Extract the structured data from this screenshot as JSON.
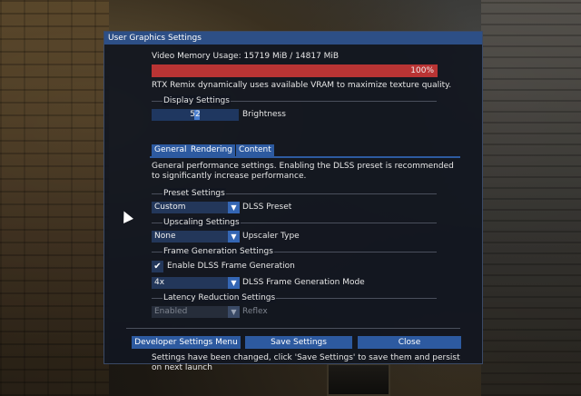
{
  "window": {
    "title": "User Graphics Settings"
  },
  "vram": {
    "label": "Video Memory Usage: 15719 MiB / 14817 MiB",
    "percent_text": "100%",
    "fill_fraction": 1.0,
    "note": "RTX Remix dynamically uses available VRAM to maximize texture quality.",
    "bar_color": "#b93434"
  },
  "display_settings": {
    "heading": "Display Settings",
    "brightness": {
      "value": "52",
      "label": "Brightness"
    }
  },
  "tabs": [
    {
      "label": "General",
      "active": true
    },
    {
      "label": "Rendering",
      "active": false
    },
    {
      "label": "Content",
      "active": false
    }
  ],
  "general": {
    "description_line1": "General performance settings. Enabling the DLSS preset is recommended",
    "description_line2": "to significantly increase performance.",
    "preset": {
      "heading": "Preset Settings",
      "value": "Custom",
      "label": "DLSS Preset"
    },
    "upscaling": {
      "heading": "Upscaling Settings",
      "value": "None",
      "label": "Upscaler Type"
    },
    "frame_generation": {
      "heading": "Frame Generation Settings",
      "enable_label": "Enable DLSS Frame Generation",
      "enabled": true,
      "mode_value": "4x",
      "mode_label": "DLSS Frame Generation Mode"
    },
    "latency": {
      "heading": "Latency Reduction Settings",
      "value": "Enabled",
      "label": "Reflex",
      "disabled": true
    }
  },
  "footer": {
    "developer_button": "Developer Settings Menu",
    "save_button": "Save Settings",
    "close_button": "Close",
    "notice_line1": "Settings have been changed, click 'Save Settings' to save them and persist",
    "notice_line2": "on next launch"
  },
  "icons": {
    "dropdown": "chevron-down-icon",
    "checkmark": "checkmark-icon",
    "cursor": "mouse-pointer-icon"
  },
  "colors": {
    "titlebar": "#2d4f86",
    "accent": "#2d5aa0",
    "panel": "#121620"
  }
}
